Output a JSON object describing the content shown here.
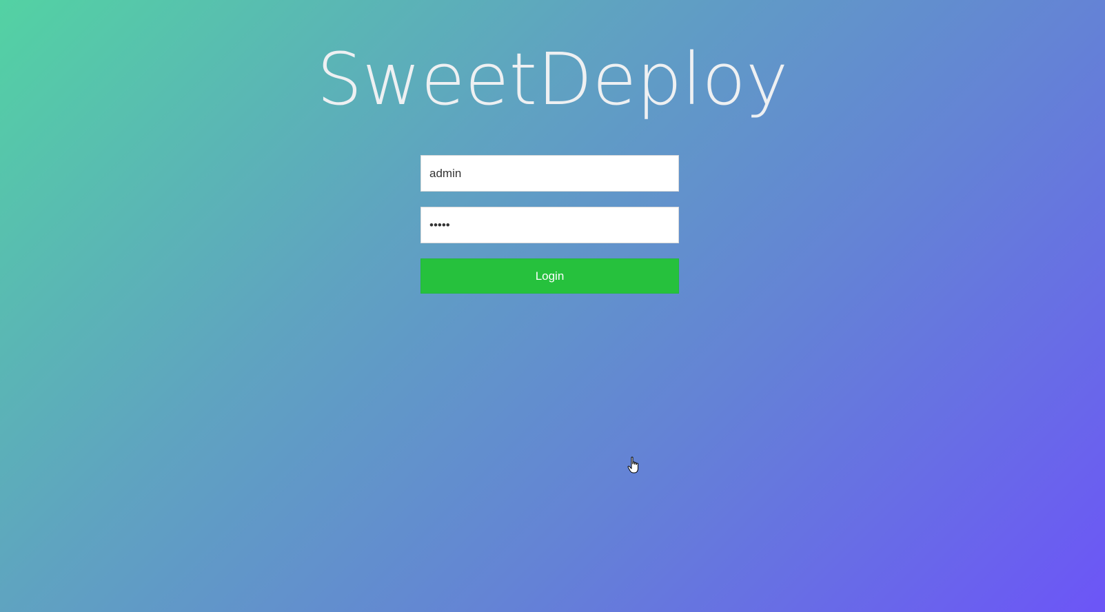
{
  "app": {
    "title": "SweetDeploy"
  },
  "login_form": {
    "username_value": "admin",
    "password_value": "•••••",
    "login_label": "Login"
  },
  "colors": {
    "gradient_start": "#53d2a3",
    "gradient_end": "#6c55f7",
    "login_button": "#26c13d",
    "title_text": "#eef0f2"
  },
  "icons": {
    "cursor": "hand-pointer-icon"
  }
}
